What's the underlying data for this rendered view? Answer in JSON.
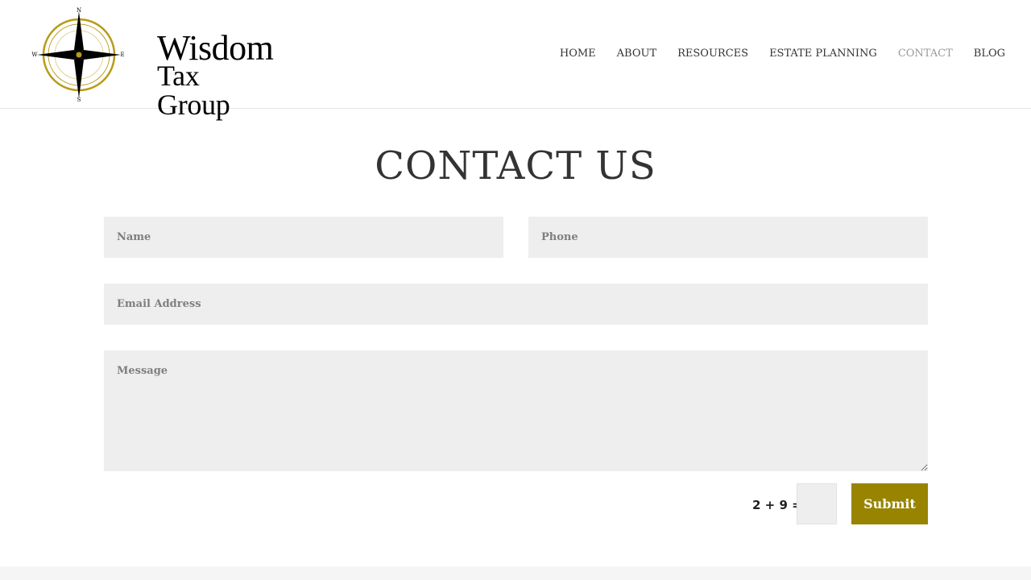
{
  "brand": {
    "line1": "Wisdom",
    "line2": "Tax Group",
    "compass_letters": {
      "n": "N",
      "s": "S",
      "e": "E",
      "w": "W"
    },
    "icon": "compass-rose-icon",
    "accent_color": "#b89b1a"
  },
  "nav": {
    "items": [
      {
        "label": "HOME",
        "active": false
      },
      {
        "label": "ABOUT",
        "active": false
      },
      {
        "label": "RESOURCES",
        "active": false
      },
      {
        "label": "ESTATE PLANNING",
        "active": false
      },
      {
        "label": "CONTACT",
        "active": true
      },
      {
        "label": "BLOG",
        "active": false
      }
    ]
  },
  "page": {
    "title": "CONTACT US"
  },
  "form": {
    "name_placeholder": "Name",
    "phone_placeholder": "Phone",
    "email_placeholder": "Email Address",
    "message_placeholder": "Message",
    "captcha_label": "2 + 9 =",
    "captcha_value": "",
    "submit_label": "Submit"
  },
  "colors": {
    "button": "#988400",
    "field_bg": "#eeeeee",
    "nav_active": "#999999",
    "text": "#333333"
  }
}
